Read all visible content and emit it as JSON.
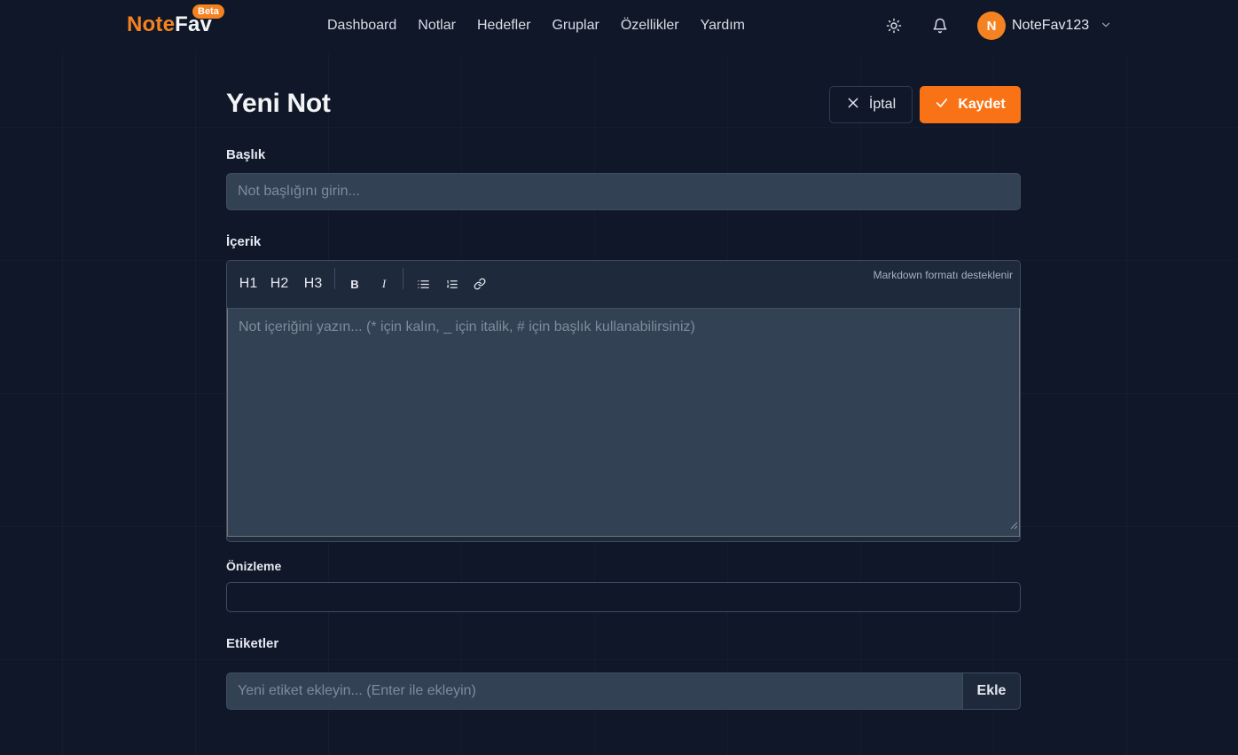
{
  "header": {
    "logo_part1": "Note",
    "logo_part2": "Fav",
    "beta_badge": "Beta",
    "nav": [
      "Dashboard",
      "Notlar",
      "Hedefler",
      "Gruplar",
      "Özellikler",
      "Yardım"
    ],
    "theme_icon": "sun-icon",
    "notification_icon": "bell-icon",
    "avatar_initial": "N",
    "username": "NoteFav123",
    "user_menu_icon": "chevron-down-icon"
  },
  "page": {
    "title": "Yeni Not",
    "cancel_label": "İptal",
    "save_label": "Kaydet"
  },
  "form": {
    "title_label": "Başlık",
    "title_placeholder": "Not başlığını girin...",
    "title_value": "",
    "content_label": "İçerik",
    "toolbar": {
      "h1": "H1",
      "h2": "H2",
      "h3": "H3",
      "bold": "B",
      "italic": "I",
      "markdown_hint": "Markdown formatı desteklenir"
    },
    "content_placeholder": "Not içeriğini yazın... (* için kalın, _ için italik, # için başlık kullanabilirsiniz)",
    "content_value": "",
    "preview_label": "Önizleme",
    "tags_label": "Etiketler",
    "tags_placeholder": "Yeni etiket ekleyin... (Enter ile ekleyin)",
    "add_label": "Ekle"
  },
  "colors": {
    "background": "#0f1729",
    "accent": "#f97316",
    "input_bg": "#334155"
  }
}
